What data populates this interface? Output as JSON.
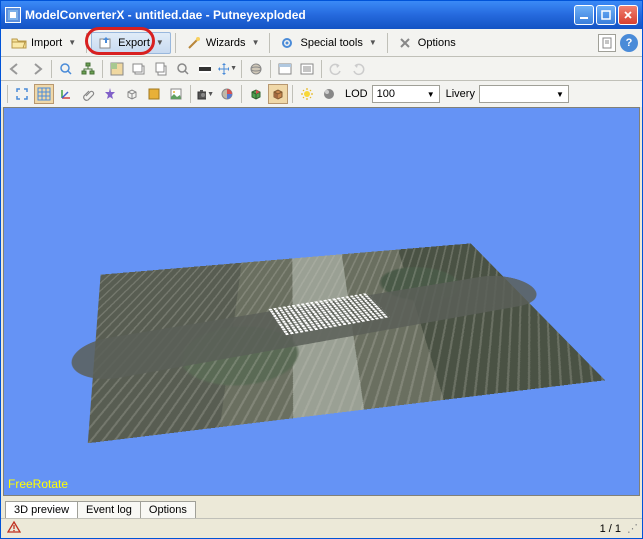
{
  "title": "ModelConverterX - untitled.dae - Putneyexploded",
  "menubar": {
    "import": "Import",
    "export": "Export",
    "wizards": "Wizards",
    "special_tools": "Special tools",
    "options": "Options"
  },
  "toolbar2": {
    "lod_label": "LOD",
    "lod_value": "100",
    "livery_label": "Livery"
  },
  "viewport": {
    "mode": "FreeRotate"
  },
  "tabs": {
    "preview": "3D preview",
    "eventlog": "Event log",
    "options": "Options"
  },
  "statusbar": {
    "pages": "1 / 1"
  }
}
